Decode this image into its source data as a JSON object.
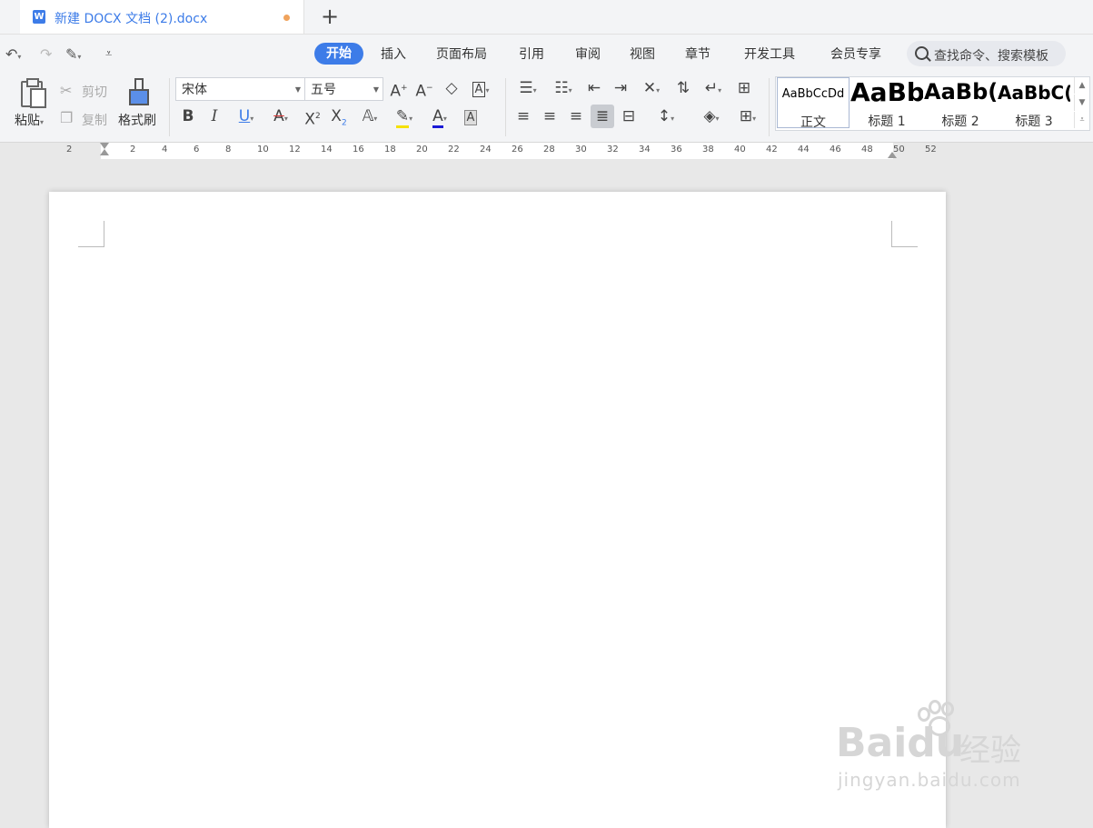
{
  "tab": {
    "title": "新建 DOCX 文档 (2).docx",
    "app_icon": "W"
  },
  "new_tab": "+",
  "menu": {
    "items": [
      "开始",
      "插入",
      "页面布局",
      "引用",
      "审阅",
      "视图",
      "章节",
      "开发工具",
      "会员专享"
    ],
    "active": "开始"
  },
  "search": {
    "placeholder": "查找命令、搜索模板"
  },
  "clipboard": {
    "paste": "粘贴",
    "cut": "剪切",
    "copy": "复制",
    "format_painter": "格式刷"
  },
  "font": {
    "name": "宋体",
    "size": "五号"
  },
  "styles": [
    {
      "sample": "AaBbCcDd",
      "name": "正文"
    },
    {
      "sample": "AaBb",
      "name": "标题 1"
    },
    {
      "sample": "AaBb(",
      "name": "标题 2"
    },
    {
      "sample": "AaBbC(",
      "name": "标题 3"
    }
  ],
  "ruler": {
    "numbers": [
      "2",
      "2",
      "4",
      "6",
      "8",
      "10",
      "12",
      "14",
      "16",
      "18",
      "20",
      "22",
      "24",
      "26",
      "28",
      "30",
      "32",
      "34",
      "36",
      "38",
      "40",
      "42",
      "44",
      "46",
      "48",
      "50",
      "52"
    ]
  },
  "watermark": {
    "brand": "Baidu",
    "cn": "经验",
    "url": "jingyan.baidu.com"
  },
  "colors": {
    "accent": "#3d7ce8",
    "modified_dot": "#f0a35c",
    "highlight": "#f5e100",
    "font_color": "#1a1ad6"
  }
}
